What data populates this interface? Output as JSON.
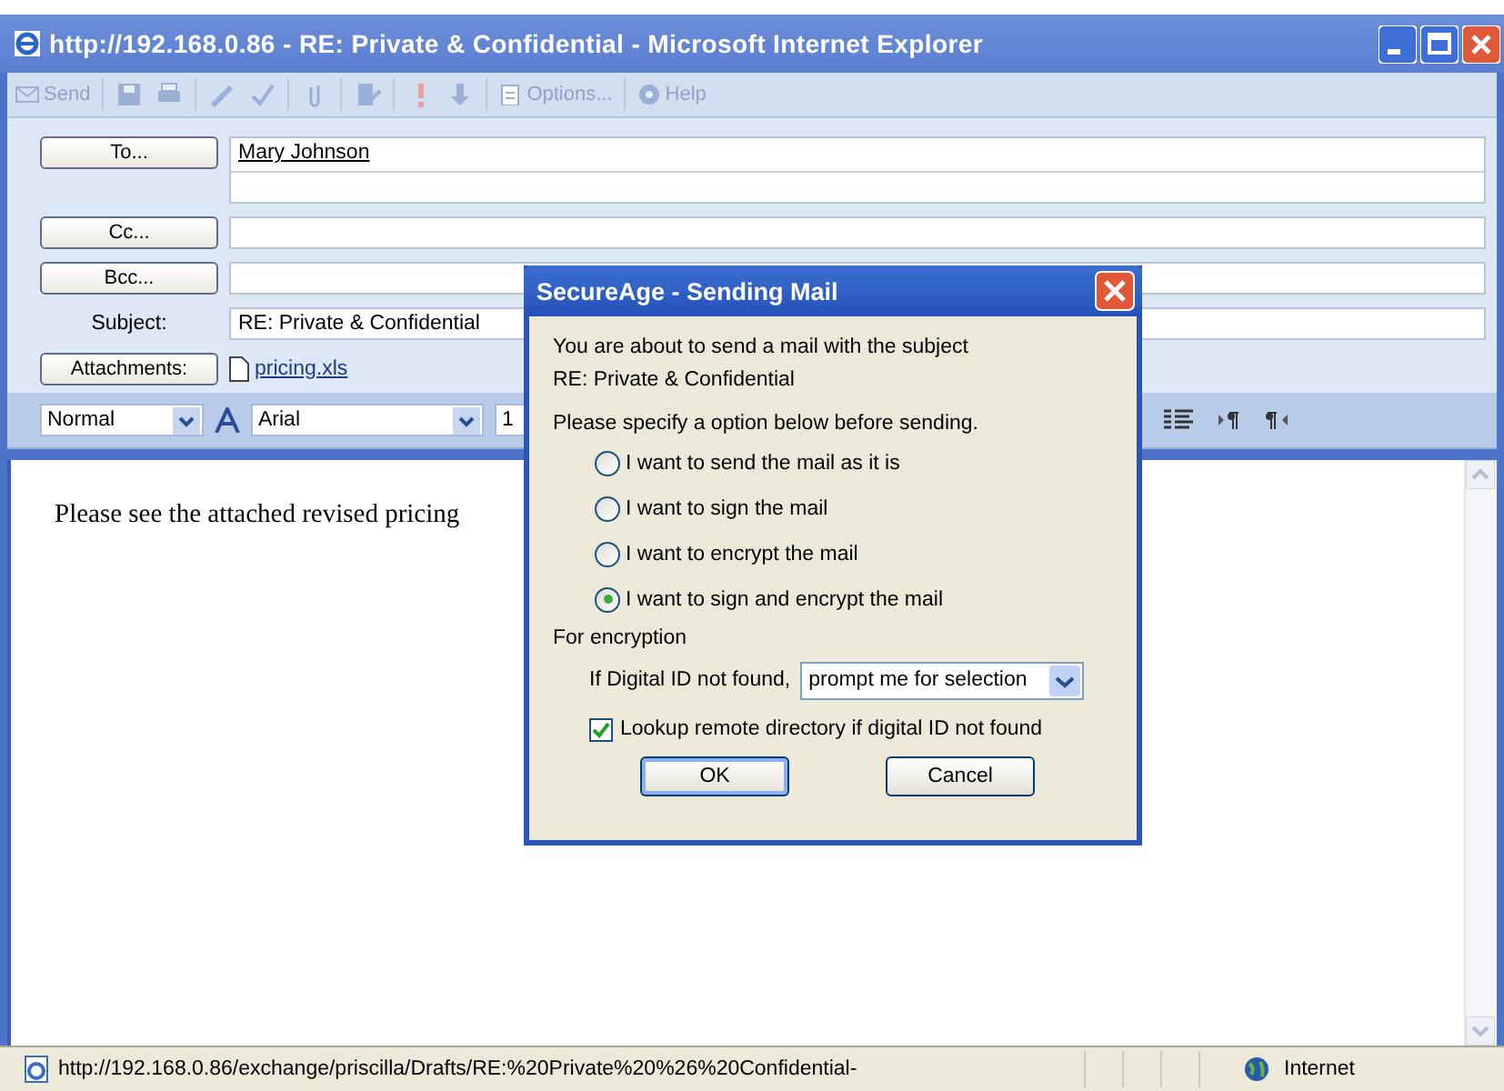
{
  "window": {
    "title": "http://192.168.0.86 - RE: Private & Confidential - Microsoft Internet Explorer"
  },
  "toolbar": {
    "buttons": [
      {
        "label": "Send"
      },
      {
        "label": "Options..."
      },
      {
        "label": "Help"
      }
    ]
  },
  "header": {
    "to": {
      "button": "To...",
      "value": "Mary Johnson"
    },
    "cc": {
      "button": "Cc..."
    },
    "bcc": {
      "button": "Bcc..."
    },
    "subject": {
      "label": "Subject:",
      "value": "RE: Private & Confidential"
    },
    "attachments": {
      "button": "Attachments:",
      "file": "pricing.xls"
    }
  },
  "format_bar": {
    "style": "Normal",
    "font": "Arial",
    "size": "1"
  },
  "body": {
    "text": "Please see the attached revised pricing"
  },
  "status_bar": {
    "url": "http://192.168.0.86/exchange/priscilla/Drafts/RE:%20Private%20%26%20Confidential-",
    "zone": "Internet"
  },
  "dialog": {
    "title": "SecureAge - Sending Mail",
    "lines": [
      "You are about to send a mail with the subject",
      "RE: Private & Confidential"
    ],
    "prompt": "Please specify a option below before sending.",
    "options": [
      {
        "label": "I want to send the mail as it is",
        "selected": false
      },
      {
        "label": "I want to sign the mail",
        "selected": false
      },
      {
        "label": "I want to encrypt the mail",
        "selected": false
      },
      {
        "label": "I want to sign and encrypt the mail",
        "selected": true
      }
    ],
    "section": "For encryption",
    "id_label": "If Digital ID not found,",
    "id_select": "prompt me for selection",
    "lookup": {
      "label": "Lookup remote directory if digital ID not found",
      "checked": true
    },
    "buttons": [
      "OK",
      "Cancel"
    ]
  }
}
